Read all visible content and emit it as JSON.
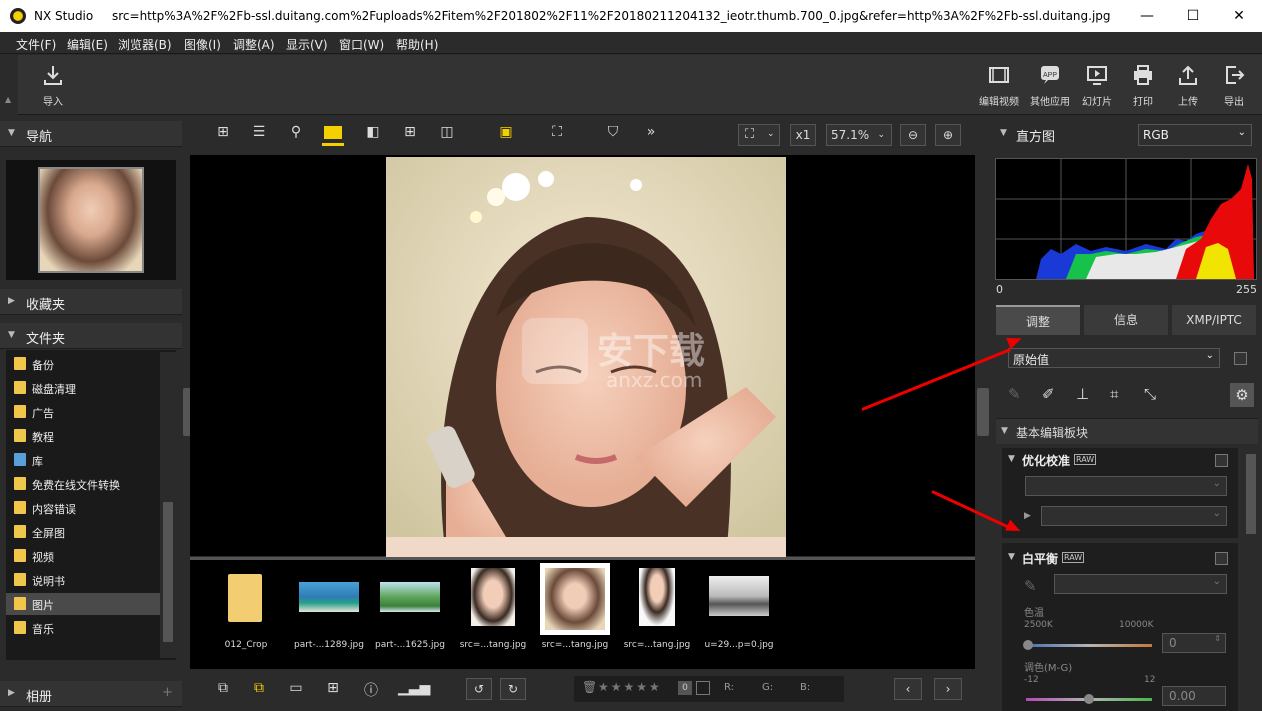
{
  "window": {
    "app_name": "NX Studio",
    "title": "src=http%3A%2F%2Fb-ssl.duitang.com%2Fuploads%2Fitem%2F201802%2F11%2F20180211204132_ieotr.thumb.700_0.jpg&refer=http%3A%2F%2Fb-ssl.duitang.jpg",
    "minimize": "—",
    "maximize": "☐",
    "close": "✕"
  },
  "menu": [
    "文件(F)",
    "编辑(E)",
    "浏览器(B)",
    "图像(I)",
    "调整(A)",
    "显示(V)",
    "窗口(W)",
    "帮助(H)"
  ],
  "toolbar": {
    "import": "导入",
    "right": [
      "编辑视频",
      "其他应用",
      "幻灯片",
      "打印",
      "上传",
      "导出"
    ],
    "app_badge": "APP"
  },
  "left": {
    "navigator": "导航",
    "favorites": "收藏夹",
    "folders": "文件夹",
    "albums": "相册",
    "folder_items": [
      "备份",
      "磁盘清理",
      "广告",
      "教程",
      "库",
      "免费在线文件转换",
      "内容错误",
      "全屏图",
      "视频",
      "说明书",
      "图片",
      "音乐"
    ],
    "selected_folder": "图片"
  },
  "viewer": {
    "zoom_mult": "x1",
    "zoom_pct": "57.1%"
  },
  "watermark": {
    "text_cn": "安下载",
    "text_en": "anxz.com"
  },
  "filmstrip": [
    "012_Crop",
    "part-...1289.jpg",
    "part-...1625.jpg",
    "src=...tang.jpg",
    "src=...tang.jpg",
    "src=...tang.jpg",
    "u=29...p=0.jpg"
  ],
  "status": {
    "r": "R:",
    "g": "G:",
    "b": "B:",
    "rating_zero": "0"
  },
  "right": {
    "histogram": "直方图",
    "channel": "RGB",
    "hist_min": "0",
    "hist_max": "255",
    "tabs": [
      "调整",
      "信息",
      "XMP/IPTC"
    ],
    "preset": "原始值",
    "basic": "基本编辑板块",
    "pc": "优化校准",
    "raw": "RAW",
    "wb": "白平衡",
    "temp_label": "色温",
    "temp_min": "2500K",
    "temp_max": "10000K",
    "temp_val": "0",
    "tint_label": "调色(M-G)",
    "tint_min": "-12",
    "tint_max": "12",
    "tint_val": "0.00"
  },
  "colors": {
    "accent_yellow": "#f5d000",
    "arrow_red": "#e00000"
  }
}
